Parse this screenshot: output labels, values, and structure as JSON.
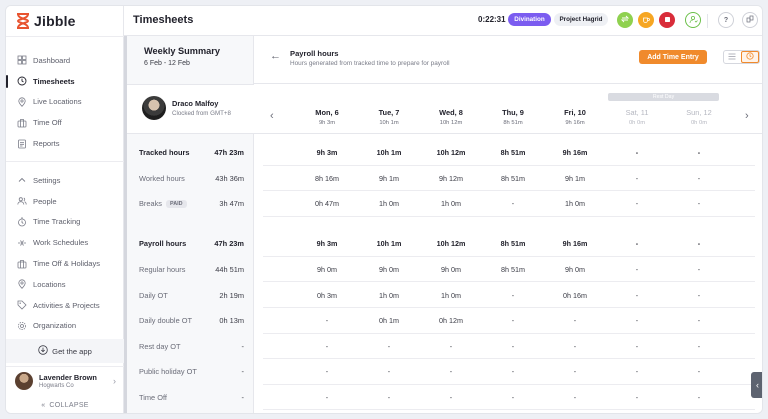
{
  "app": {
    "name": "Jibble"
  },
  "sidebar": {
    "items": [
      {
        "label": "Dashboard",
        "icon": "dashboard-icon",
        "active": false
      },
      {
        "label": "Timesheets",
        "icon": "clock-icon",
        "active": true
      },
      {
        "label": "Live Locations",
        "icon": "location-pin-icon",
        "active": false
      },
      {
        "label": "Time Off",
        "icon": "suitcase-icon",
        "active": false
      },
      {
        "label": "Reports",
        "icon": "report-icon",
        "active": false
      }
    ],
    "settings_items": [
      {
        "label": "Settings",
        "icon": "chevron-up-icon"
      },
      {
        "label": "People",
        "icon": "people-icon"
      },
      {
        "label": "Time Tracking",
        "icon": "time-tracking-icon"
      },
      {
        "label": "Work Schedules",
        "icon": "schedule-icon"
      },
      {
        "label": "Time Off & Holidays",
        "icon": "suitcase-icon"
      },
      {
        "label": "Locations",
        "icon": "location-pin-icon"
      },
      {
        "label": "Activities & Projects",
        "icon": "tag-icon"
      },
      {
        "label": "Organization",
        "icon": "gear-icon"
      }
    ],
    "get_app": "Get the app",
    "user": {
      "name": "Lavender Brown",
      "org": "Hogwarts Co"
    },
    "collapse": "COLLAPSE"
  },
  "topbar": {
    "title": "Timesheets",
    "timer": "0:22:31",
    "activity": "Divination",
    "project": "Project Hagrid"
  },
  "summary": {
    "title": "Weekly Summary",
    "range": "6 Feb - 12 Feb",
    "person": {
      "name": "Draco Malfoy",
      "timezone": "Clocked from GMT+8"
    },
    "paid_badge": "PAID",
    "rows": [
      {
        "label": "Tracked hours",
        "value": "47h 23m",
        "bold": true
      },
      {
        "label": "Worked hours",
        "value": "43h 36m",
        "bold": false
      },
      {
        "label": "Breaks",
        "value": "3h 47m",
        "bold": false,
        "badge": true
      },
      {
        "label": "Payroll hours",
        "value": "47h 23m",
        "bold": true
      },
      {
        "label": "Regular hours",
        "value": "44h 51m",
        "bold": false
      },
      {
        "label": "Daily OT",
        "value": "2h 19m",
        "bold": false
      },
      {
        "label": "Daily double OT",
        "value": "0h 13m",
        "bold": false
      },
      {
        "label": "Rest day OT",
        "value": "-",
        "bold": false
      },
      {
        "label": "Public holiday OT",
        "value": "-",
        "bold": false
      },
      {
        "label": "Time Off",
        "value": "-",
        "bold": false
      }
    ]
  },
  "main": {
    "title": "Payroll hours",
    "subtitle": "Hours generated from tracked time to prepare for payroll",
    "add_button": "Add Time Entry",
    "rest_day": "Rest Day",
    "days": [
      {
        "name": "Mon, 6",
        "total": "9h 3m",
        "off": false
      },
      {
        "name": "Tue, 7",
        "total": "10h 1m",
        "off": false
      },
      {
        "name": "Wed, 8",
        "total": "10h 12m",
        "off": false
      },
      {
        "name": "Thu, 9",
        "total": "8h 51m",
        "off": false
      },
      {
        "name": "Fri, 10",
        "total": "9h 16m",
        "off": false
      },
      {
        "name": "Sat, 11",
        "total": "0h 0m",
        "off": true
      },
      {
        "name": "Sun, 12",
        "total": "0h 0m",
        "off": true
      }
    ],
    "rows": [
      {
        "bold": true,
        "cells": [
          "9h 3m",
          "10h 1m",
          "10h 12m",
          "8h 51m",
          "9h 16m",
          "-",
          "-"
        ]
      },
      {
        "bold": false,
        "cells": [
          "8h 16m",
          "9h 1m",
          "9h 12m",
          "8h 51m",
          "9h 1m",
          "-",
          "-"
        ]
      },
      {
        "bold": false,
        "cells": [
          "0h 47m",
          "1h 0m",
          "1h 0m",
          "-",
          "1h 0m",
          "-",
          "-"
        ]
      },
      {
        "bold": true,
        "cells": [
          "9h 3m",
          "10h 1m",
          "10h 12m",
          "8h 51m",
          "9h 16m",
          "-",
          "-"
        ]
      },
      {
        "bold": false,
        "cells": [
          "9h 0m",
          "9h 0m",
          "9h 0m",
          "8h 51m",
          "9h 0m",
          "-",
          "-"
        ]
      },
      {
        "bold": false,
        "cells": [
          "0h 3m",
          "1h 0m",
          "1h 0m",
          "-",
          "0h 16m",
          "-",
          "-"
        ]
      },
      {
        "bold": false,
        "cells": [
          "-",
          "0h 1m",
          "0h 12m",
          "-",
          "-",
          "-",
          "-"
        ]
      },
      {
        "bold": false,
        "cells": [
          "-",
          "-",
          "-",
          "-",
          "-",
          "-",
          "-"
        ]
      },
      {
        "bold": false,
        "cells": [
          "-",
          "-",
          "-",
          "-",
          "-",
          "-",
          "-"
        ]
      },
      {
        "bold": false,
        "cells": [
          "-",
          "-",
          "-",
          "-",
          "-",
          "-",
          "-"
        ]
      }
    ]
  },
  "colors": {
    "accent": "#f08a2c",
    "purple": "#7b5cf0",
    "text": "#22222c"
  }
}
